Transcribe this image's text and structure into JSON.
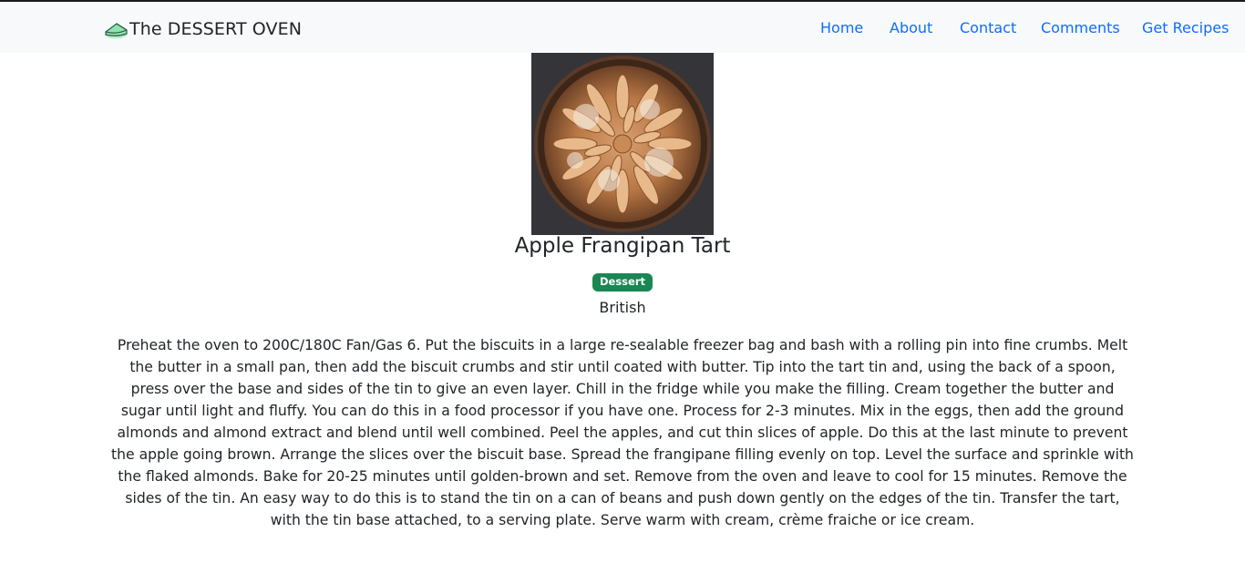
{
  "navbar": {
    "brand": "The DESSERT OVEN",
    "links": [
      "Home",
      "About",
      "Contact",
      "Comments",
      "Get Recipes"
    ]
  },
  "icons": {
    "brand": "cake-slice-icon"
  },
  "colors": {
    "link": "#0d6efd",
    "badge": "#198754",
    "navbar_bg": "#f8f9fa",
    "brand_icon": "#8fe3b0"
  },
  "recipe": {
    "title": "Apple Frangipan Tart",
    "category": "Dessert",
    "area": "British",
    "instructions": "Preheat the oven to 200C/180C Fan/Gas 6. Put the biscuits in a large re-sealable freezer bag and bash with a rolling pin into fine crumbs. Melt the butter in a small pan, then add the biscuit crumbs and stir until coated with butter. Tip into the tart tin and, using the back of a spoon, press over the base and sides of the tin to give an even layer. Chill in the fridge while you make the filling. Cream together the butter and sugar until light and fluffy. You can do this in a food processor if you have one. Process for 2-3 minutes. Mix in the eggs, then add the ground almonds and almond extract and blend until well combined. Peel the apples, and cut thin slices of apple. Do this at the last minute to prevent the apple going brown. Arrange the slices over the biscuit base. Spread the frangipane filling evenly on top. Level the surface and sprinkle with the flaked almonds. Bake for 20-25 minutes until golden-brown and set. Remove from the oven and leave to cool for 15 minutes. Remove the sides of the tin. An easy way to do this is to stand the tin on a can of beans and push down gently on the edges of the tin. Transfer the tart, with the tin base attached, to a serving plate. Serve warm with cream, crème fraiche or ice cream."
  }
}
